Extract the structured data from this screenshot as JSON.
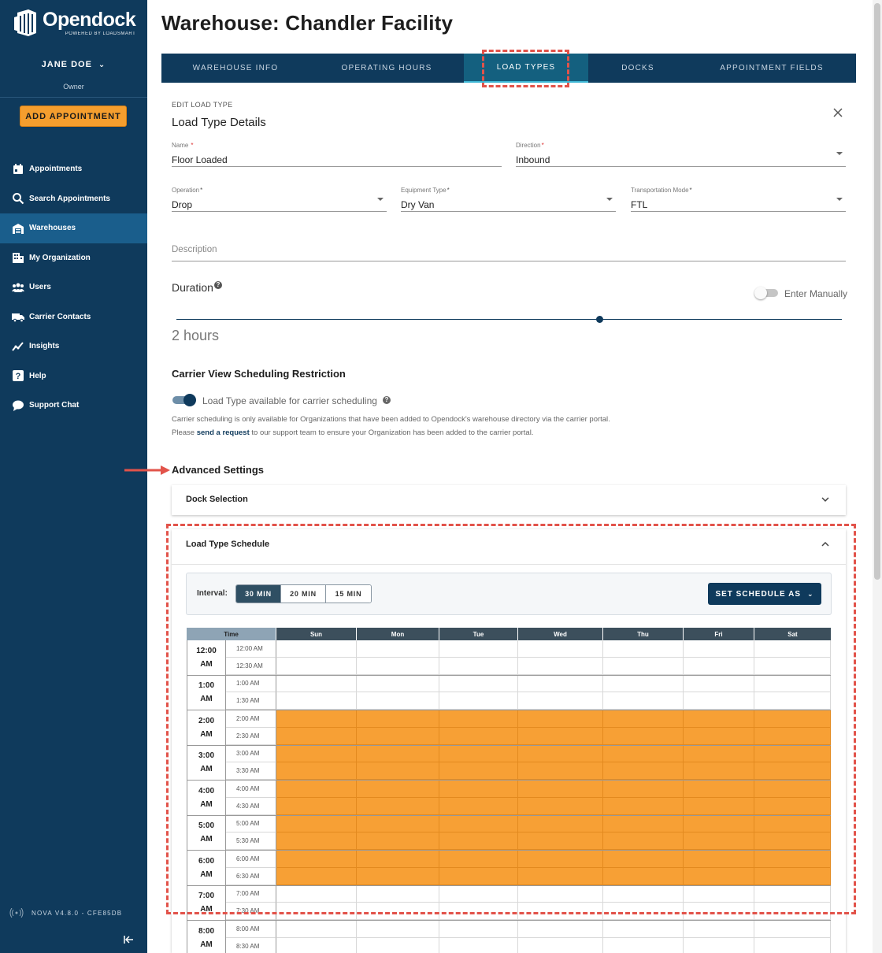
{
  "brand": {
    "name": "Opendock",
    "sub": "POWERED BY LOADSMART"
  },
  "user": {
    "name": "JANE DOE",
    "role": "Owner"
  },
  "add_appointment": "ADD APPOINTMENT",
  "nav": [
    {
      "label": "Appointments",
      "icon": "calendar-icon"
    },
    {
      "label": "Search Appointments",
      "icon": "search-icon"
    },
    {
      "label": "Warehouses",
      "icon": "warehouse-icon",
      "active": true
    },
    {
      "label": "My Organization",
      "icon": "building-icon"
    },
    {
      "label": "Users",
      "icon": "users-icon"
    },
    {
      "label": "Carrier Contacts",
      "icon": "truck-icon"
    },
    {
      "label": "Insights",
      "icon": "chart-line-icon"
    },
    {
      "label": "Help",
      "icon": "help-icon"
    },
    {
      "label": "Support Chat",
      "icon": "chat-icon"
    }
  ],
  "version": "NOVA V4.8.0 - CFE85DB",
  "page_title": "Warehouse: Chandler Facility",
  "tabs": [
    "WAREHOUSE INFO",
    "OPERATING HOURS",
    "LOAD TYPES",
    "DOCKS",
    "APPOINTMENT FIELDS"
  ],
  "active_tab": "LOAD TYPES",
  "form": {
    "kicker": "EDIT LOAD TYPE",
    "title": "Load Type Details",
    "name": {
      "label": "Name",
      "value": "Floor Loaded"
    },
    "direction": {
      "label": "Direction",
      "value": "Inbound"
    },
    "operation": {
      "label": "Operation",
      "value": "Drop"
    },
    "equipment_type": {
      "label": "Equipment Type",
      "value": "Dry Van"
    },
    "transportation_mode": {
      "label": "Transportation Mode",
      "value": "FTL"
    },
    "description": {
      "placeholder": "Description"
    },
    "duration": {
      "label": "Duration",
      "value": "2 hours",
      "enter_manually": "Enter Manually",
      "enter_manually_on": false,
      "slider_fraction": 0.64
    }
  },
  "carrier_view": {
    "title": "Carrier View Scheduling Restriction",
    "toggle_label": "Load Type available for carrier scheduling",
    "toggle_on": true,
    "note_line1": "Carrier scheduling is only available for Organizations that have been added to Opendock's warehouse directory via the carrier portal.",
    "note_line2_pre": "Please",
    "note_link": "send a request",
    "note_line2_post": "to our support team to ensure your Organization has been added to the carrier portal."
  },
  "advanced": {
    "title": "Advanced Settings",
    "dock_selection": "Dock Selection",
    "schedule_title": "Load Type Schedule",
    "interval_label": "Interval:",
    "intervals": [
      "30 MIN",
      "20 MIN",
      "15 MIN"
    ],
    "active_interval": "30 MIN",
    "set_schedule": "SET SCHEDULE AS"
  },
  "schedule": {
    "time_header": "Time",
    "days": [
      "Sun",
      "Mon",
      "Tue",
      "Wed",
      "Thu",
      "Fri",
      "Sat"
    ],
    "hours": [
      {
        "hour": "12:00",
        "ampm": "AM",
        "slots": [
          "12:00 AM",
          "12:30 AM"
        ],
        "on": [
          false,
          false
        ]
      },
      {
        "hour": "1:00",
        "ampm": "AM",
        "slots": [
          "1:00 AM",
          "1:30 AM"
        ],
        "on": [
          false,
          false
        ]
      },
      {
        "hour": "2:00",
        "ampm": "AM",
        "slots": [
          "2:00 AM",
          "2:30 AM"
        ],
        "on": [
          true,
          true
        ]
      },
      {
        "hour": "3:00",
        "ampm": "AM",
        "slots": [
          "3:00 AM",
          "3:30 AM"
        ],
        "on": [
          true,
          true
        ]
      },
      {
        "hour": "4:00",
        "ampm": "AM",
        "slots": [
          "4:00 AM",
          "4:30 AM"
        ],
        "on": [
          true,
          true
        ]
      },
      {
        "hour": "5:00",
        "ampm": "AM",
        "slots": [
          "5:00 AM",
          "5:30 AM"
        ],
        "on": [
          true,
          true
        ]
      },
      {
        "hour": "6:00",
        "ampm": "AM",
        "slots": [
          "6:00 AM",
          "6:30 AM"
        ],
        "on": [
          true,
          true
        ]
      },
      {
        "hour": "7:00",
        "ampm": "AM",
        "slots": [
          "7:00 AM",
          "7:30 AM"
        ],
        "on": [
          false,
          false
        ]
      },
      {
        "hour": "8:00",
        "ampm": "AM",
        "slots": [
          "8:00 AM",
          "8:30 AM"
        ],
        "on": [
          false,
          false
        ]
      }
    ],
    "selected_color": "#f7a035"
  },
  "colors": {
    "sidebar": "#0f3a5c",
    "accent": "#f59e2e",
    "annotation": "#e2534a"
  }
}
